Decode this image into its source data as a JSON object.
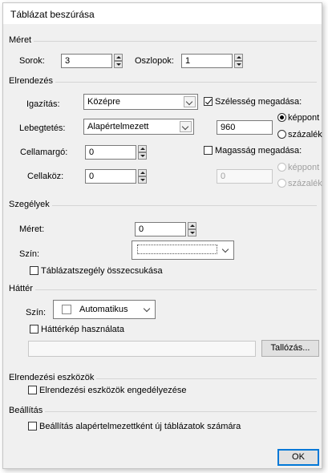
{
  "dialog": {
    "title": "Táblázat beszúrása"
  },
  "meret": {
    "section": "Méret",
    "rows_label": "Sorok:",
    "rows_value": "3",
    "cols_label": "Oszlopok:",
    "cols_value": "1"
  },
  "elrendezes": {
    "section": "Elrendezés",
    "align_label": "Igazítás:",
    "align_value": "Középre",
    "float_label": "Lebegtetés:",
    "float_value": "Alapértelmezett",
    "padding_label": "Cellamargó:",
    "padding_value": "0",
    "spacing_label": "Cellaköz:",
    "spacing_value": "0",
    "width_checkbox_label": "Szélesség megadása:",
    "width_checked": true,
    "width_value": "960",
    "width_unit_px": "képpont",
    "width_unit_pct": "százalék",
    "height_checkbox_label": "Magasság megadása:",
    "height_checked": false,
    "height_value": "0",
    "height_unit_px": "képpont",
    "height_unit_pct": "százalék"
  },
  "szegelyek": {
    "section": "Szegélyek",
    "size_label": "Méret:",
    "size_value": "0",
    "color_label": "Szín:",
    "collapse_label": "Táblázatszegély összecsukása"
  },
  "hatter": {
    "section": "Háttér",
    "color_label": "Szín:",
    "color_value": "Automatikus",
    "image_checkbox_label": "Háttérkép használata",
    "image_path_value": "",
    "browse_label": "Tallózás..."
  },
  "eszkozok": {
    "section": "Elrendezési eszközök",
    "enable_label": "Elrendezési eszközök engedélyezése"
  },
  "beallitas": {
    "section": "Beállítás",
    "default_label": "Beállítás alapértelmezettként új táblázatok számára"
  },
  "footer": {
    "ok_label": "OK"
  },
  "colors": {
    "dialog_bg": "#f0f0f0",
    "accent": "#0078d7"
  }
}
